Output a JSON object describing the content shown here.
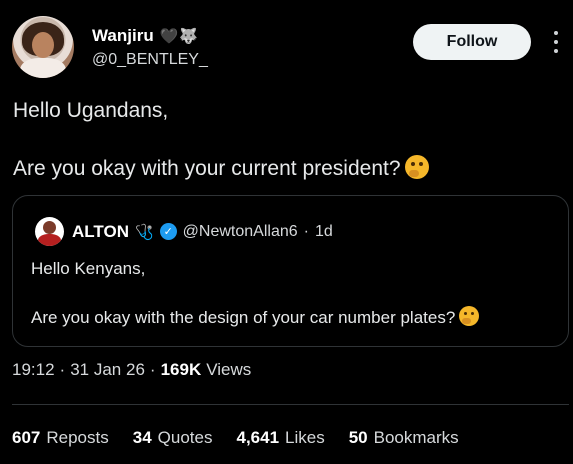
{
  "author": {
    "display_name": "Wanjiru",
    "name_emoji": "🖤🐺",
    "handle": "@0_BENTLEY_"
  },
  "actions": {
    "follow_label": "Follow"
  },
  "tweet": {
    "line1": "Hello Ugandans,",
    "line2": "Are you okay with your current president?"
  },
  "quote": {
    "name": "ALTON",
    "name_emoji": "🩺",
    "handle": "@NewtonAllan6",
    "separator": "·",
    "time": "1d",
    "line1": "Hello Kenyans,",
    "line2": "Are you okay with the design of your car number plates?"
  },
  "meta": {
    "time": "19:12",
    "separator": "·",
    "date": "31 Jan 26",
    "views_count": "169K",
    "views_label": "Views"
  },
  "stats": {
    "reposts_count": "607",
    "reposts_label": "Reposts",
    "quotes_count": "34",
    "quotes_label": "Quotes",
    "likes_count": "4,641",
    "likes_label": "Likes",
    "bookmarks_count": "50",
    "bookmarks_label": "Bookmarks"
  }
}
